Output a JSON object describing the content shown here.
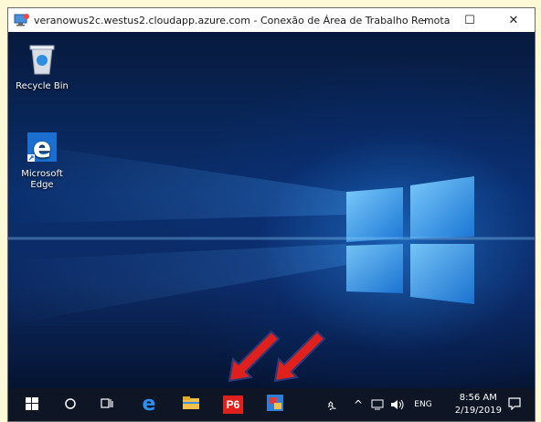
{
  "window": {
    "title": "veranowus2c.westus2.cloudapp.azure.com - Conexão de Área de Trabalho Remota",
    "minimize_glyph": "–",
    "maximize_glyph": "☐",
    "close_glyph": "✕"
  },
  "desktop": {
    "icons": [
      {
        "label": "Recycle Bin",
        "icon": "recycle-bin-icon"
      },
      {
        "label": "Microsoft Edge",
        "icon": "edge-icon"
      }
    ]
  },
  "taskbar": {
    "apps": [
      {
        "name": "start",
        "icon": "windows-logo-icon"
      },
      {
        "name": "search",
        "icon": "search-circle-icon"
      },
      {
        "name": "task-view",
        "icon": "task-view-icon"
      },
      {
        "name": "edge",
        "icon": "edge-icon"
      },
      {
        "name": "file-explorer",
        "icon": "folder-icon"
      },
      {
        "name": "p6",
        "label": "P6",
        "icon": "p6-icon"
      },
      {
        "name": "app",
        "icon": "app-icon"
      }
    ],
    "tray": {
      "people_glyph": "ጷ",
      "chevron_glyph": "^",
      "language": "ENG",
      "time": "8:56 AM",
      "date": "2/19/2019"
    }
  },
  "colors": {
    "accent_red": "#e0201c",
    "arrow_outline": "#2a3a78"
  }
}
